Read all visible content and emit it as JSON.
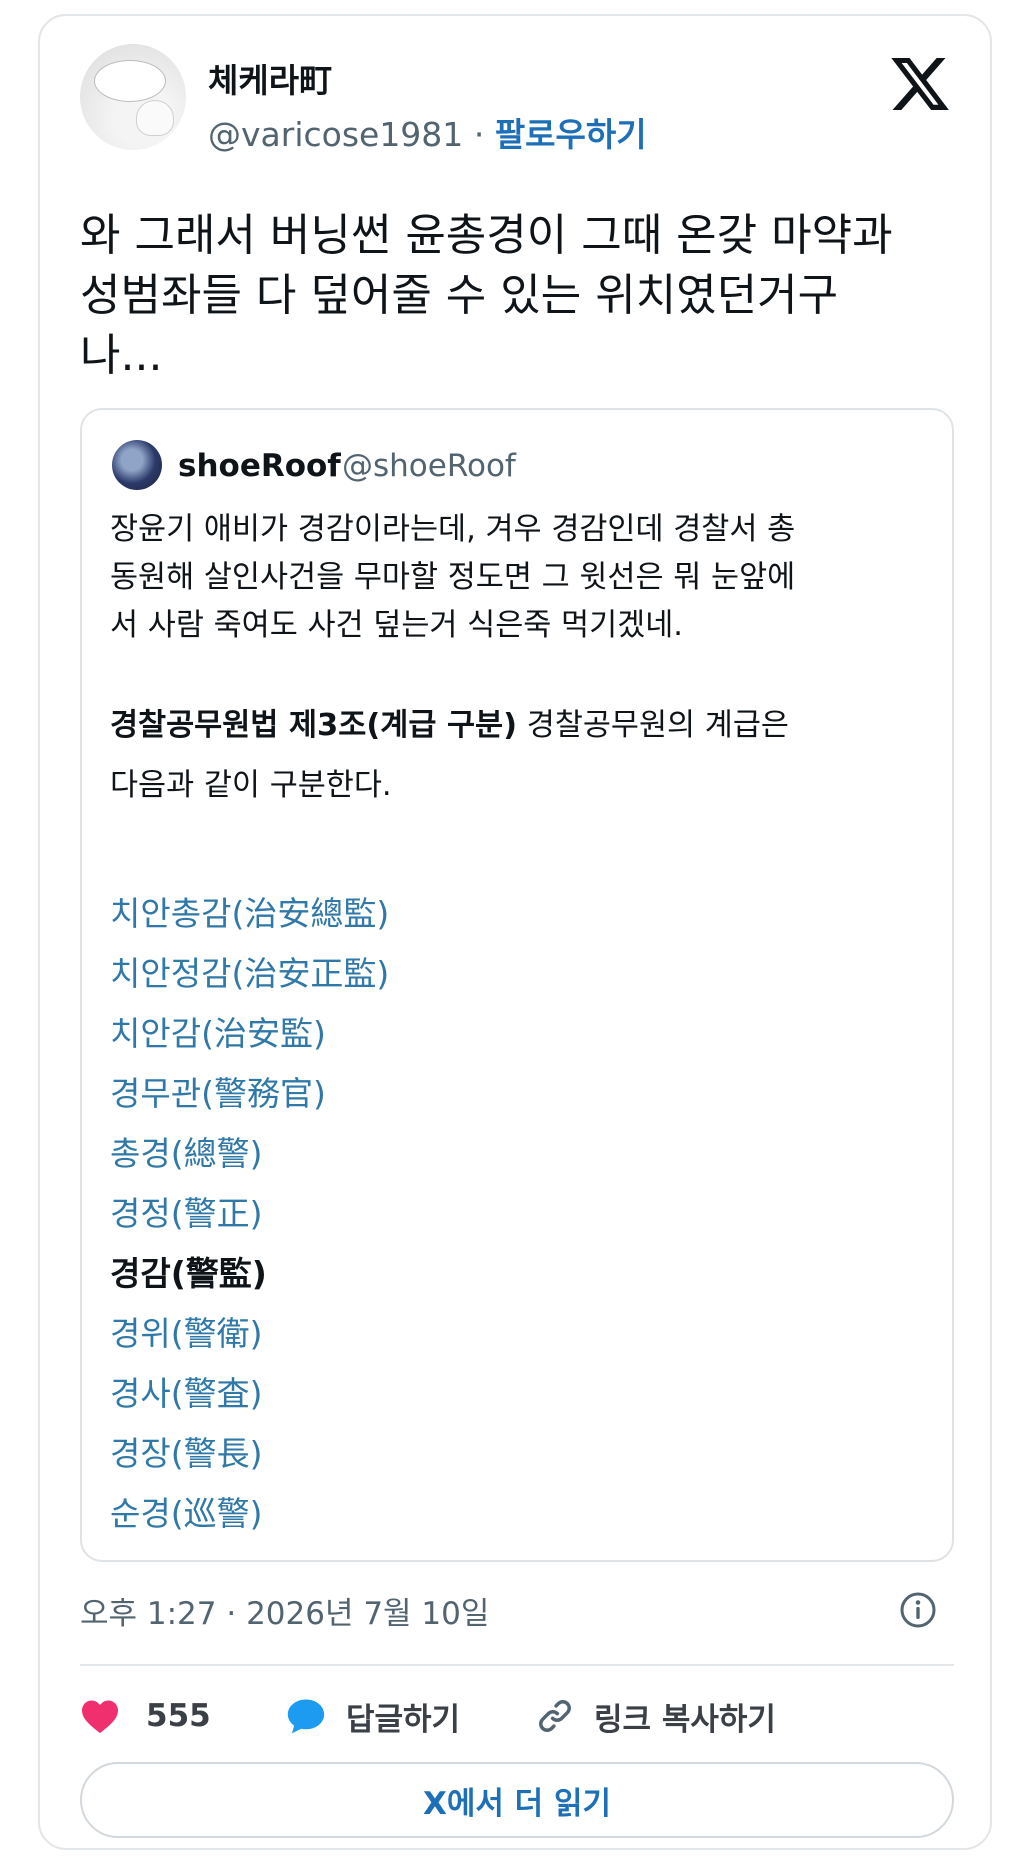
{
  "author": {
    "display_name": "체케라町",
    "handle": "@varicose1981",
    "separator": "·",
    "follow_label": "팔로우하기"
  },
  "tweet": {
    "text": "와 그래서 버닝썬 윤총경이 그때 온갖 마약과\n성범좌들 다 덮어줄 수 있는 위치였던거구\n나...",
    "timestamp": "오후 1:27 · 2026년 7월 10일"
  },
  "quote": {
    "display_name": "shoeRoof",
    "handle": "@shoeRoof",
    "body_lines": [
      "장윤기 애비가 경감이라는데, 겨우 경감인데 경찰서 총",
      "동원해 살인사건을 무마할 정도면 그 윗선은 뭐 눈앞에",
      "서 사람 죽여도 사건 덮는거 식은죽 먹기겠네."
    ],
    "law_title": "경찰공무원법 제3조(계급 구분)",
    "law_text_1": " 경찰공무원의 계급은",
    "law_text_2": "다음과 같이 구분한다.",
    "ranks": [
      {
        "label": "치안총감(治安總監)",
        "linked": true
      },
      {
        "label": "치안정감(治安正監)",
        "linked": true
      },
      {
        "label": "치안감(治安監)",
        "linked": true
      },
      {
        "label": "경무관(警務官)",
        "linked": true
      },
      {
        "label": "총경(總警)",
        "linked": true
      },
      {
        "label": "경정(警正)",
        "linked": true
      },
      {
        "label": "경감(警監)",
        "linked": false
      },
      {
        "label": "경위(警衛)",
        "linked": true
      },
      {
        "label": "경사(警査)",
        "linked": true
      },
      {
        "label": "경장(警長)",
        "linked": true
      },
      {
        "label": "순경(巡警)",
        "linked": true
      }
    ]
  },
  "actions": {
    "like_count": "555",
    "reply_label": "답글하기",
    "copy_link_label": "링크 복사하기"
  },
  "read_more_label": "X에서 더 읽기",
  "colors": {
    "link": "#2f78a8",
    "follow": "#1d6fb8",
    "like_heart": "#f0306e",
    "reply_bubble": "#1d9bf0",
    "muted_text": "#536471"
  },
  "icons": {
    "platform": "x-logo-icon",
    "info": "info-icon",
    "like": "heart-icon",
    "reply": "speech-bubble-icon",
    "copy_link": "link-icon"
  }
}
